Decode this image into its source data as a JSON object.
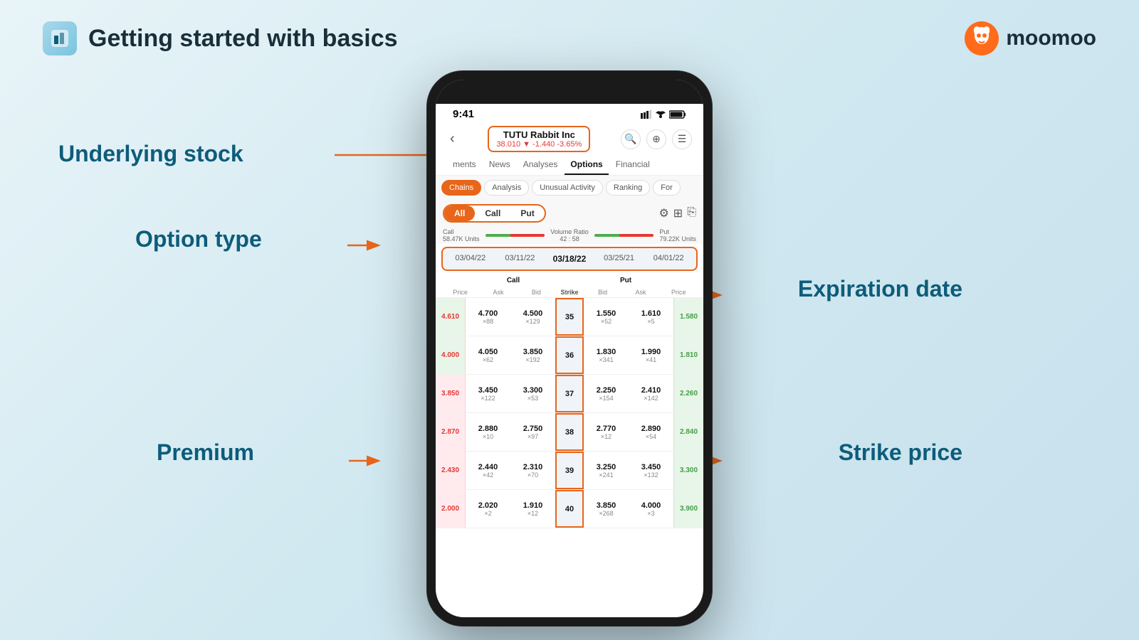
{
  "header": {
    "title": "Getting started with basics",
    "moomoo_label": "moomoo"
  },
  "labels": {
    "underlying_stock": "Underlying stock",
    "option_type": "Option type",
    "premium": "Premium",
    "expiration_date": "Expiration date",
    "strike_price": "Strike price",
    "chains_analysis": "Chains Analysis"
  },
  "phone": {
    "status_time": "9:41",
    "stock": {
      "name": "TUTU Rabbit Inc",
      "price": "38.010",
      "change": "-1.440",
      "change_pct": "-3.65%"
    },
    "nav_tabs": [
      "ments",
      "News",
      "Analyses",
      "Options",
      "Financial"
    ],
    "active_nav": "Options",
    "filter_chips": [
      "Chains",
      "Analysis",
      "Unusual Activity",
      "Ranking",
      "For"
    ],
    "active_chip": "Chains",
    "option_types": [
      "All",
      "Call",
      "Put"
    ],
    "active_option_type": "All",
    "volume": {
      "call_units": "58.47K Units",
      "ratio": "42 : 58",
      "put_units": "79.22K Units"
    },
    "dates": [
      "03/04/22",
      "03/11/22",
      "03/18/22",
      "03/25/21",
      "04/01/22"
    ],
    "active_date": "03/18/22",
    "table": {
      "call_header": "Call",
      "put_header": "Put",
      "strike_header": "Strike",
      "col_headers_call": [
        "Price",
        "Ask",
        "Bid"
      ],
      "col_headers_put": [
        "Bid",
        "Ask",
        "Price"
      ],
      "rows": [
        {
          "call_price": "4.610",
          "ask": "4.700",
          "ask_x": "×88",
          "bid": "4.500",
          "bid_x": "×129",
          "strike": "35",
          "put_bid": "1.550",
          "put_bid_x": "×52",
          "put_ask": "1.610",
          "put_ask_x": "×5",
          "put_price": "1.580",
          "call_itm": true
        },
        {
          "call_price": "4.000",
          "ask": "4.050",
          "ask_x": "×62",
          "bid": "3.850",
          "bid_x": "×192",
          "strike": "36",
          "put_bid": "1.830",
          "put_bid_x": "×341",
          "put_ask": "1.990",
          "put_ask_x": "×41",
          "put_price": "1.810",
          "call_itm": true
        },
        {
          "call_price": "3.850",
          "ask": "3.450",
          "ask_x": "×122",
          "bid": "3.300",
          "bid_x": "×53",
          "strike": "37",
          "put_bid": "2.250",
          "put_bid_x": "×154",
          "put_ask": "2.410",
          "put_ask_x": "×142",
          "put_price": "2.260",
          "call_itm": false
        },
        {
          "call_price": "2.870",
          "ask": "2.880",
          "ask_x": "×10",
          "bid": "2.750",
          "bid_x": "×97",
          "strike": "38",
          "put_bid": "2.770",
          "put_bid_x": "×12",
          "put_ask": "2.890",
          "put_ask_x": "×54",
          "put_price": "2.840",
          "call_itm": false
        },
        {
          "call_price": "2.430",
          "ask": "2.440",
          "ask_x": "×42",
          "bid": "2.310",
          "bid_x": "×70",
          "strike": "39",
          "put_bid": "3.250",
          "put_bid_x": "×241",
          "put_ask": "3.450",
          "put_ask_x": "×132",
          "put_price": "3.300",
          "call_itm": false
        },
        {
          "call_price": "2.000",
          "ask": "2.020",
          "ask_x": "×2",
          "bid": "1.910",
          "bid_x": "×12",
          "strike": "40",
          "put_bid": "3.850",
          "put_bid_x": "×268",
          "put_ask": "4.000",
          "put_ask_x": "×3",
          "put_price": "3.900",
          "call_itm": false
        }
      ]
    }
  }
}
